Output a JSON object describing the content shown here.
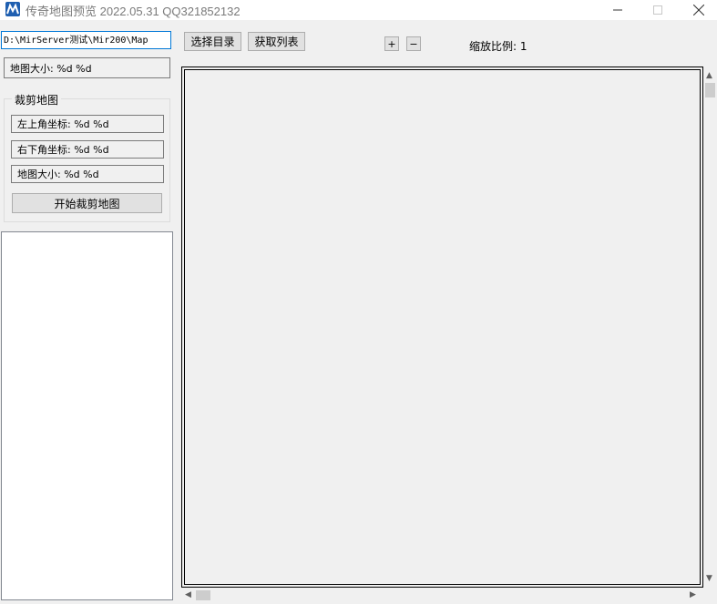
{
  "window": {
    "title": "传奇地图预览 2022.05.31 QQ321852132",
    "icon": "app-logo-icon",
    "controls": [
      "minimize-icon",
      "maximize-icon",
      "close-icon"
    ]
  },
  "toolbar": {
    "path_value": "D:\\MirServer测试\\Mir200\\Map",
    "select_dir_label": "选择目录",
    "get_list_label": "获取列表",
    "zoom_in_label": "+",
    "zoom_out_label": "−",
    "zoom_text": "缩放比例: 1"
  },
  "left_panel": {
    "map_size_label": "地图大小: %d  %d",
    "crop_group": {
      "title": "裁剪地图",
      "top_left_label": "左上角坐标: %d  %d",
      "bottom_right_label": "右下角坐标: %d  %d",
      "map_size_label": "地图大小: %d  %d",
      "start_button_label": "开始裁剪地图"
    },
    "map_list": []
  },
  "scrollbars": {
    "up_arrow": "▲",
    "down_arrow": "▼",
    "left_arrow": "◀",
    "right_arrow": "▶"
  }
}
